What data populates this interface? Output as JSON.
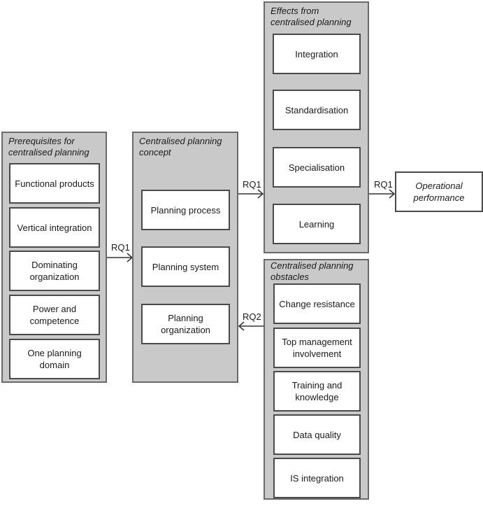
{
  "panels": {
    "prerequisites": {
      "title": "Prerequisites for centralised planning",
      "items": [
        "Functional products",
        "Vertical integration",
        "Dominating organization",
        "Power and competence",
        "One planning domain"
      ]
    },
    "concept": {
      "title": "Centralised planning concept",
      "items": [
        "Planning process",
        "Planning system",
        "Planning organization"
      ]
    },
    "effects": {
      "title": "Effects from centralised planning",
      "items": [
        "Integration",
        "Standardisation",
        "Specialisation",
        "Learning"
      ]
    },
    "obstacles": {
      "title": "Centralised planning obstacles",
      "items": [
        "Change resistance",
        "Top management involvement",
        "Training and knowledge",
        "Data quality",
        "IS integration"
      ]
    }
  },
  "outcome": "Operational performance",
  "arrows": {
    "prereq_to_concept": "RQ1",
    "concept_to_effects": "RQ1",
    "effects_to_outcome": "RQ1",
    "obstacles_to_concept": "RQ2"
  }
}
